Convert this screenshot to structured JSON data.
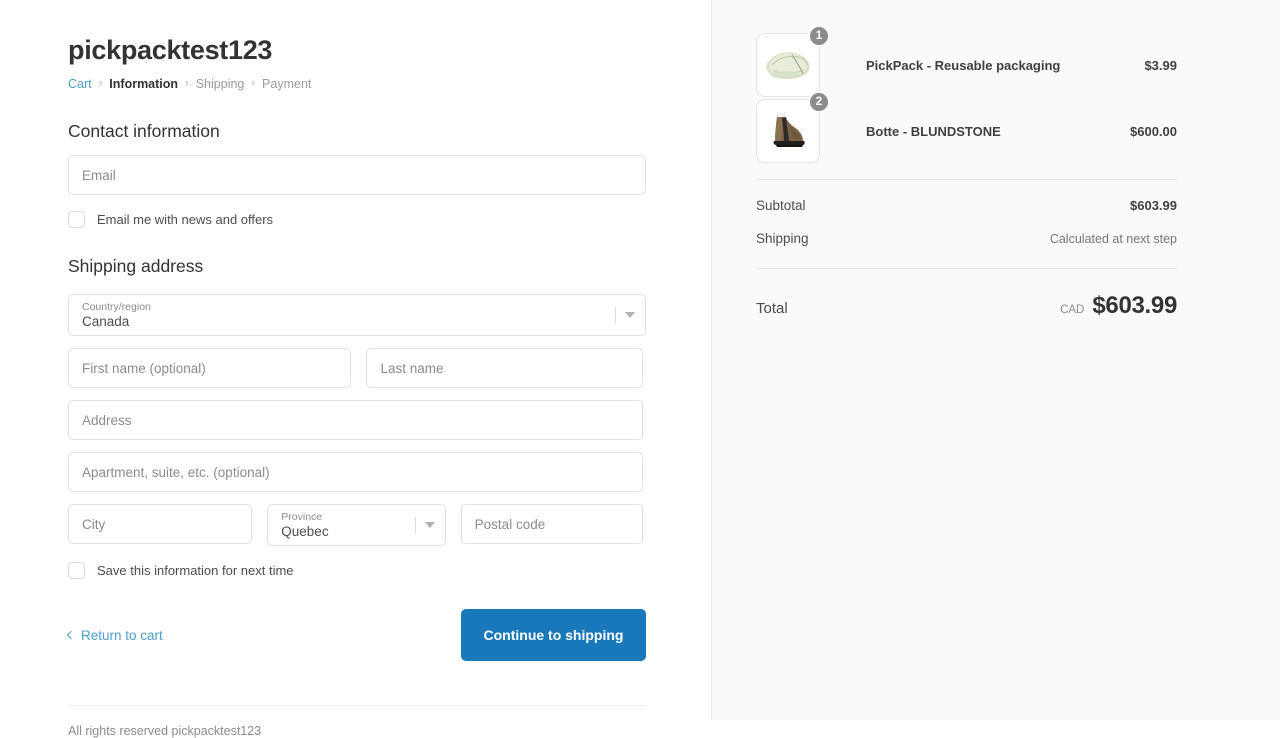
{
  "shop": {
    "title": "pickpacktest123"
  },
  "breadcrumb": {
    "cart": "Cart",
    "information": "Information",
    "shipping": "Shipping",
    "payment": "Payment",
    "separator": "›"
  },
  "contact": {
    "heading": "Contact information",
    "email_placeholder": "Email",
    "newsletter_label": "Email me with news and offers"
  },
  "shipping_address": {
    "heading": "Shipping address",
    "country_label": "Country/region",
    "country_value": "Canada",
    "first_name_placeholder": "First name (optional)",
    "last_name_placeholder": "Last name",
    "address_placeholder": "Address",
    "apartment_placeholder": "Apartment, suite, etc. (optional)",
    "city_placeholder": "City",
    "province_label": "Province",
    "province_value": "Quebec",
    "postal_placeholder": "Postal code",
    "save_info_label": "Save this information for next time"
  },
  "actions": {
    "return_to_cart": "Return to cart",
    "continue": "Continue to shipping"
  },
  "footer": {
    "text": "All rights reserved pickpacktest123"
  },
  "summary": {
    "items": [
      {
        "name": "PickPack - Reusable packaging",
        "price": "$3.99",
        "qty": "1"
      },
      {
        "name": "Botte - BLUNDSTONE",
        "price": "$600.00",
        "qty": "2"
      }
    ],
    "subtotal_label": "Subtotal",
    "subtotal_value": "$603.99",
    "shipping_label": "Shipping",
    "shipping_value": "Calculated at next step",
    "total_label": "Total",
    "total_currency": "CAD",
    "total_value": "$603.99"
  },
  "colors": {
    "accent_blue": "#1878b9",
    "link_blue": "#4d9ec9",
    "panel_bg": "#fafafa",
    "badge_grey": "#8c8c8c"
  }
}
